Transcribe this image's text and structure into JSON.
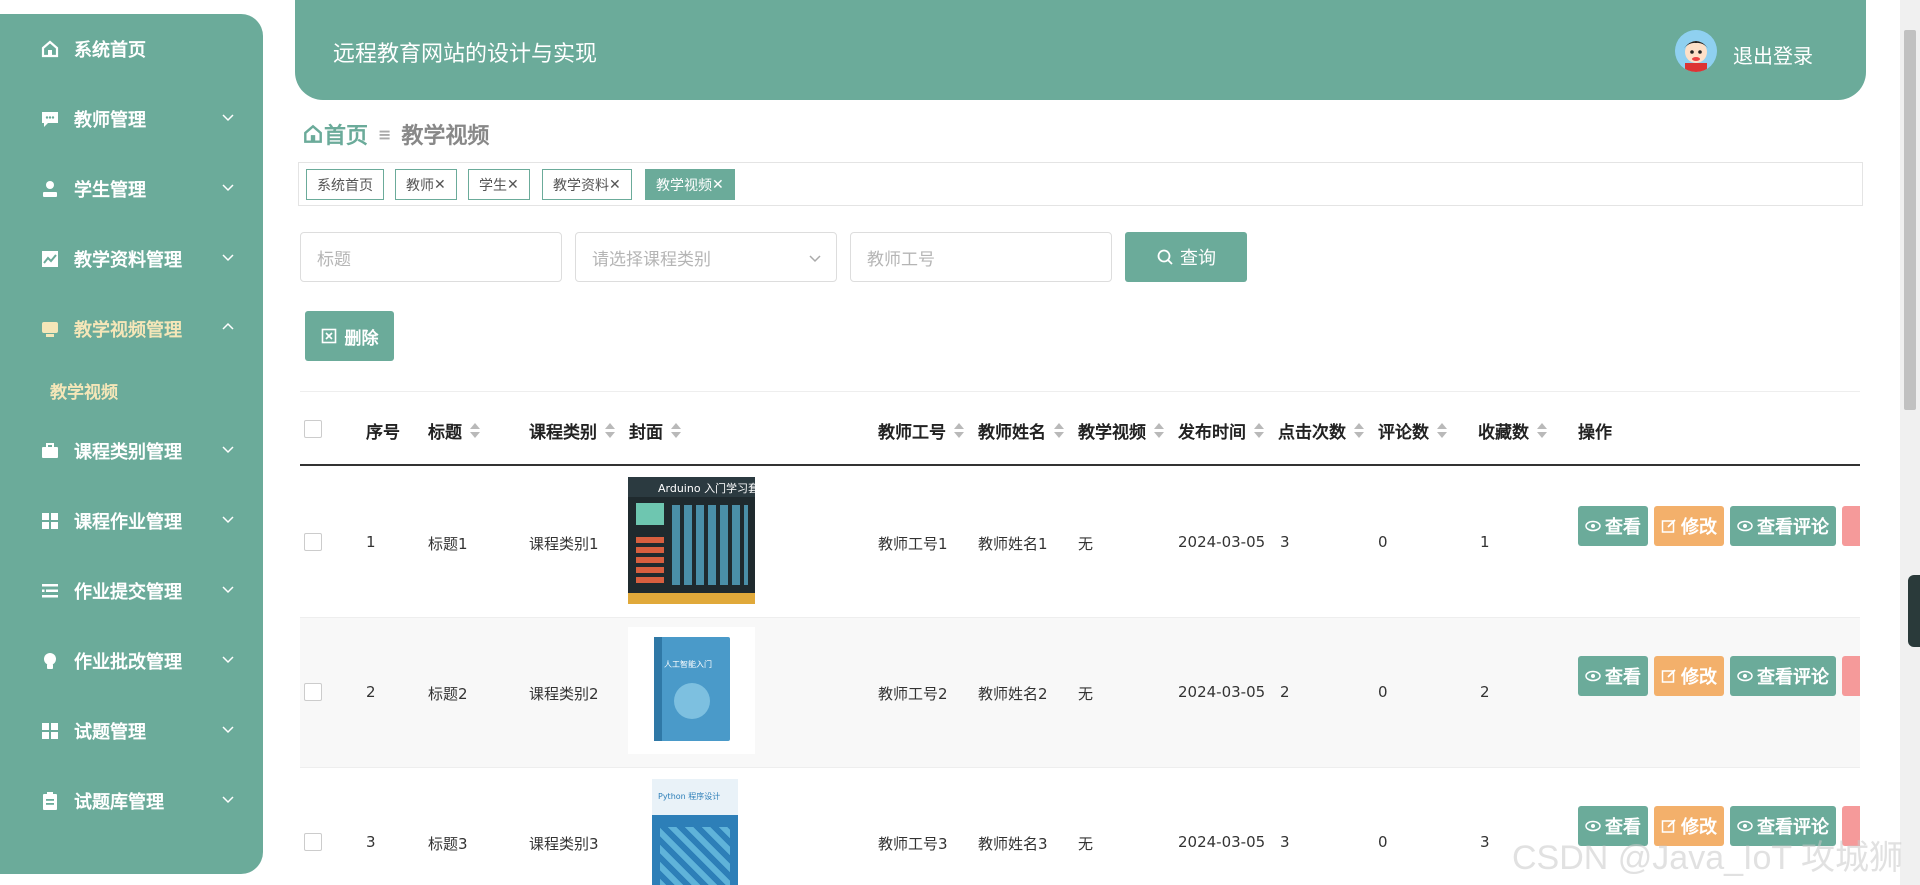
{
  "sidebar": {
    "items": [
      {
        "label": "系统首页",
        "icon": "home-icon"
      },
      {
        "label": "教师管理",
        "icon": "chat-icon"
      },
      {
        "label": "学生管理",
        "icon": "user-icon"
      },
      {
        "label": "教学资料管理",
        "icon": "chart-icon"
      },
      {
        "label": "教学视频管理",
        "icon": "monitor-icon"
      },
      {
        "label": "课程类别管理",
        "icon": "briefcase-icon"
      },
      {
        "label": "课程作业管理",
        "icon": "grid-icon"
      },
      {
        "label": "作业提交管理",
        "icon": "list-icon"
      },
      {
        "label": "作业批改管理",
        "icon": "bulb-icon"
      },
      {
        "label": "试题管理",
        "icon": "grid-icon"
      },
      {
        "label": "试题库管理",
        "icon": "clipboard-icon"
      }
    ],
    "submenu": {
      "label": "教学视频"
    }
  },
  "header": {
    "title": "远程教育网站的设计与实现",
    "logout": "退出登录"
  },
  "breadcrumb": {
    "home": "首页",
    "separator": "≡",
    "current": "教学视频"
  },
  "tags": [
    {
      "label": "系统首页"
    },
    {
      "label": "教师",
      "close": "✕"
    },
    {
      "label": "学生",
      "close": "✕"
    },
    {
      "label": "教学资料",
      "close": "✕"
    },
    {
      "label": "教学视频",
      "close": "✕"
    }
  ],
  "search": {
    "title_placeholder": "标题",
    "category_placeholder": "请选择课程类别",
    "teacher_id_placeholder": "教师工号",
    "query_label": "查询"
  },
  "actions": {
    "delete_label": "删除"
  },
  "table": {
    "headers": {
      "index": "序号",
      "title": "标题",
      "category": "课程类别",
      "cover": "封面",
      "teacher_id": "教师工号",
      "teacher_name": "教师姓名",
      "video": "教学视频",
      "publish_time": "发布时间",
      "clicks": "点击次数",
      "comments": "评论数",
      "favorites": "收藏数",
      "operation": "操作"
    },
    "rows": [
      {
        "index": "1",
        "title": "标题1",
        "category": "课程类别1",
        "teacher_id": "教师工号1",
        "teacher_name": "教师姓名1",
        "video": "无",
        "publish_time": "2024-03-05",
        "clicks": "3",
        "comments": "0",
        "favorites": "1",
        "cover_text": "Arduino 入门学习套装"
      },
      {
        "index": "2",
        "title": "标题2",
        "category": "课程类别2",
        "teacher_id": "教师工号2",
        "teacher_name": "教师姓名2",
        "video": "无",
        "publish_time": "2024-03-05",
        "clicks": "2",
        "comments": "0",
        "favorites": "2",
        "cover_text": "人工智能入门"
      },
      {
        "index": "3",
        "title": "标题3",
        "category": "课程类别3",
        "teacher_id": "教师工号3",
        "teacher_name": "教师姓名3",
        "video": "无",
        "publish_time": "2024-03-05",
        "clicks": "3",
        "comments": "0",
        "favorites": "3",
        "cover_text": "Python 程序设计"
      }
    ],
    "row_actions": {
      "view": "查看",
      "edit": "修改",
      "comments": "查看评论"
    }
  },
  "watermark": "CSDN @Java_IoT 攻城狮",
  "colors": {
    "primary": "#6bab9a",
    "warning": "#f3b06b",
    "danger": "#f59a9a",
    "active_menu": "#f5e6b8"
  }
}
